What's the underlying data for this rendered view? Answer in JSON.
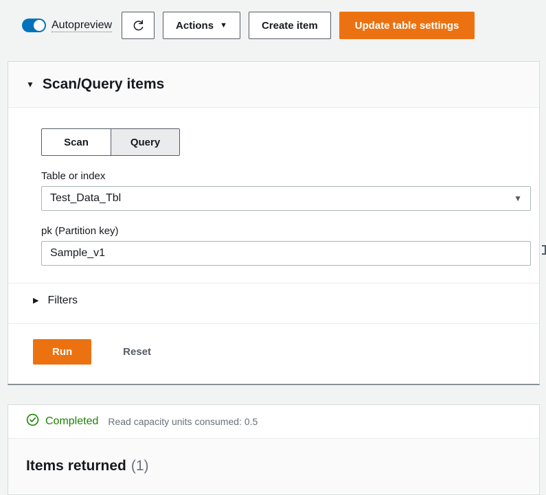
{
  "toolbar": {
    "autopreview_label": "Autopreview",
    "autopreview_enabled": true,
    "refresh_icon": "refresh-icon",
    "actions_label": "Actions",
    "actions_caret": "▼",
    "create_item_label": "Create item",
    "update_table_settings_label": "Update table settings",
    "primary_color": "#ec7211"
  },
  "scan_query_panel": {
    "caret": "▼",
    "title": "Scan/Query items",
    "mode_tabs": [
      {
        "label": "Scan",
        "selected": false
      },
      {
        "label": "Query",
        "selected": true
      }
    ],
    "table_or_index": {
      "label": "Table or index",
      "value": "Test_Data_Tbl",
      "caret": "▼"
    },
    "partition_key": {
      "label": "pk (Partition key)",
      "value": "Sample_v1"
    },
    "filters": {
      "caret": "▶",
      "label": "Filters"
    },
    "run_label": "Run",
    "reset_label": "Reset"
  },
  "results_panel": {
    "status_icon": "check-circle-icon",
    "status_label": "Completed",
    "status_color": "#1d8102",
    "capacity_text": "Read capacity units consumed: 0.5",
    "items_returned_label": "Items returned",
    "items_returned_count": "(1)"
  }
}
